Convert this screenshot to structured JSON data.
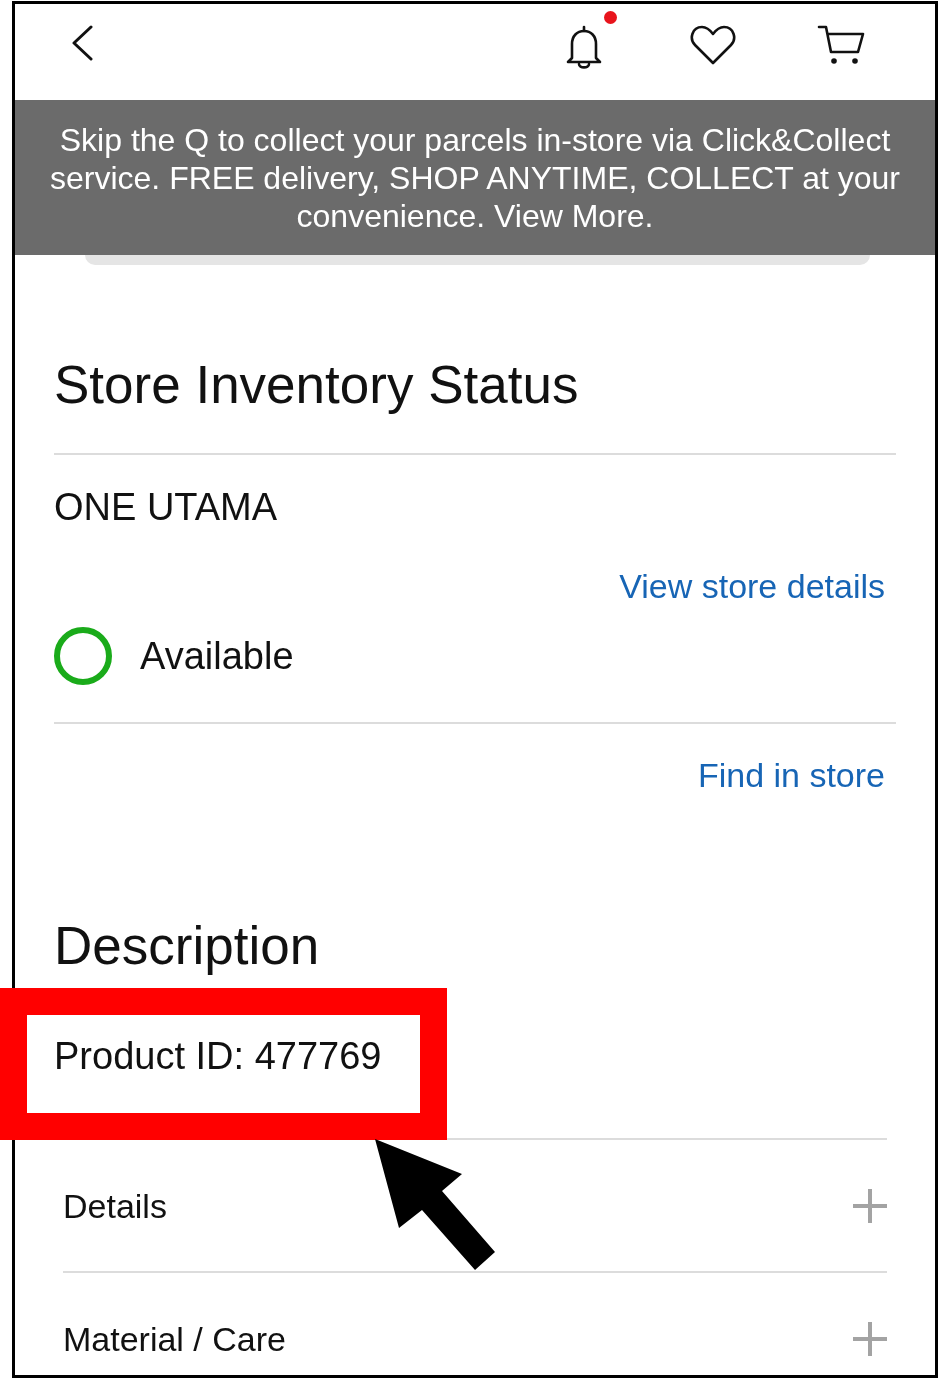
{
  "top_bar": {
    "notifications": {
      "unread": true
    }
  },
  "banner": {
    "text": "Skip the Q to collect your parcels in-store via Click&Collect service. FREE delivery, SHOP ANYTIME, COLLECT at your convenience. View More."
  },
  "store_inventory": {
    "title": "Store Inventory Status",
    "store_name": "ONE UTAMA",
    "details_link": "View store details",
    "status": {
      "text": "Available",
      "available": true
    },
    "find_link": "Find in store"
  },
  "description": {
    "title": "Description",
    "product_id": {
      "text": "Product ID: 477769",
      "highlighted": true
    },
    "sections": [
      {
        "label": "Details",
        "expanded": false
      },
      {
        "label": "Material / Care",
        "expanded": false
      }
    ]
  }
}
